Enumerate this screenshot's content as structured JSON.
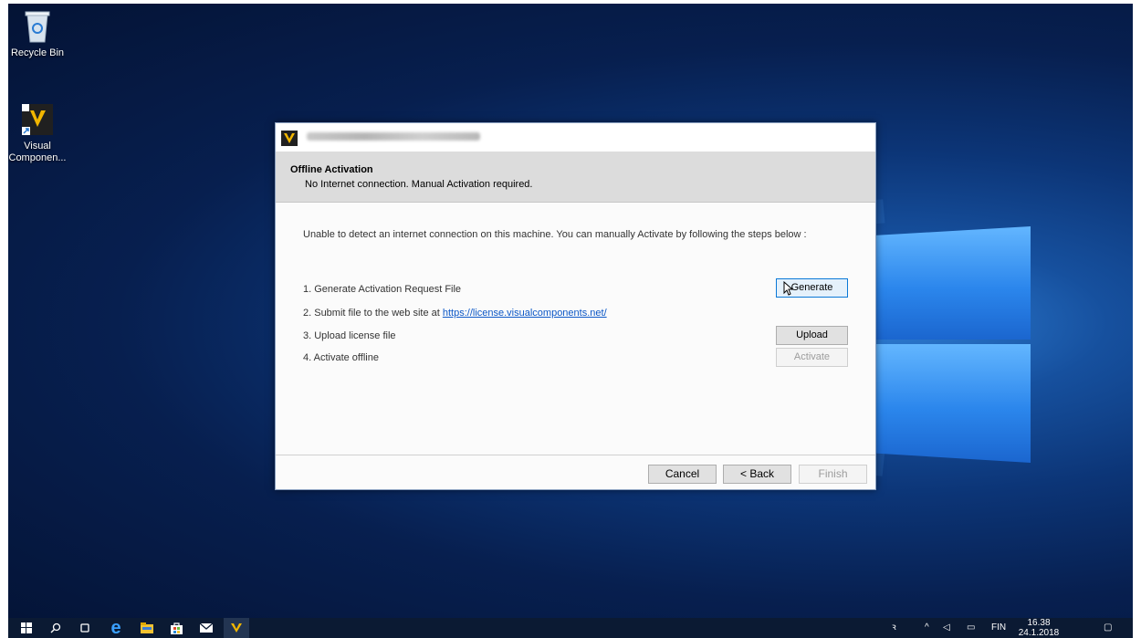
{
  "desktop": {
    "icons": [
      {
        "label": "Recycle Bin"
      },
      {
        "label": "Visual\nComponen..."
      }
    ]
  },
  "dialog": {
    "header_title": "Offline Activation",
    "header_subtitle": "No Internet connection. Manual Activation required.",
    "description": "Unable to detect an internet connection on this machine. You can manually Activate by following the steps below :",
    "steps": [
      {
        "text": "1. Generate Activation Request File",
        "button": "Generate"
      },
      {
        "text": "2. Submit file to the web site at ",
        "link": "https://license.visualcomponents.net/"
      },
      {
        "text": "3. Upload license file",
        "button": "Upload"
      },
      {
        "text": "4. Activate offline",
        "button": "Activate"
      }
    ],
    "footer": {
      "cancel": "Cancel",
      "back": "< Back",
      "finish": "Finish"
    }
  },
  "taskbar": {
    "language": "FIN",
    "time": "16.38",
    "date": "24.1.2018"
  },
  "colors": {
    "accent_yellow": "#f2b600",
    "link": "#0b57c7",
    "focus_border": "#0a78d7"
  }
}
